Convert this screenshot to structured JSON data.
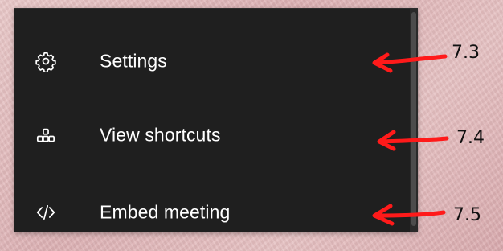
{
  "menu": {
    "items": [
      {
        "label": "Settings",
        "icon": "gear-icon"
      },
      {
        "label": "View shortcuts",
        "icon": "shortcuts-grid-icon"
      },
      {
        "label": "Embed meeting",
        "icon": "code-brackets-icon"
      }
    ]
  },
  "annotations": [
    {
      "label": "7.3"
    },
    {
      "label": "7.4"
    },
    {
      "label": "7.5"
    }
  ],
  "colors": {
    "menu_background": "#1f1f1f",
    "menu_text": "#ffffff",
    "annotation_arrow": "#ff1a1a",
    "page_background": "#e3bcbe"
  }
}
